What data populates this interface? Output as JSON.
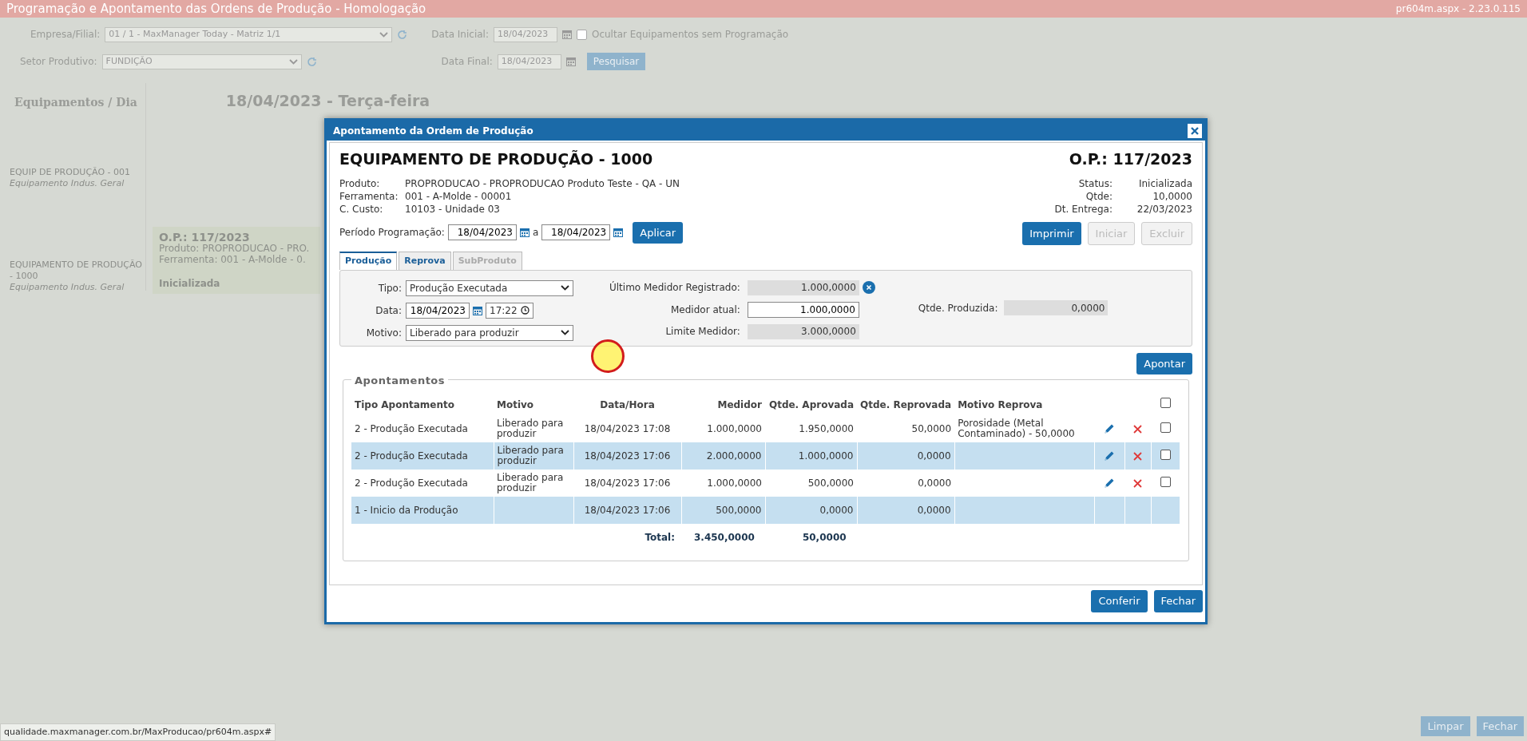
{
  "app_header": {
    "title": "Programação e Apontamento das Ordens de Produção  - Homologação",
    "version": "pr604m.aspx - 2.23.0.115"
  },
  "filters": {
    "empresa_label": "Empresa/Filial:",
    "empresa_value": "01 / 1 - MaxManager Today - Matriz 1/1",
    "setor_label": "Setor Produtivo:",
    "setor_value": "FUNDIÇÃO",
    "data_inicial_label": "Data Inicial:",
    "data_inicial": "18/04/2023",
    "data_final_label": "Data Final:",
    "data_final": "18/04/2023",
    "ocultar_label": "Ocultar Equipamentos sem Programação",
    "ocultar_checked": false,
    "search_button": "Pesquisar"
  },
  "schedule": {
    "corner": "Equipamentos / Dia",
    "day": "18/04/2023 - Terça-feira",
    "equipments": [
      {
        "name": "EQUIP DE PRODUÇÃO - 001",
        "type": "Equipamento Indus. Geral"
      },
      {
        "name": "EQUIPAMENTO DE PRODUÇÃO - 1000",
        "type": "Equipamento Indus. Geral",
        "order": {
          "title": "O.P.: 117/2023",
          "produto": "Produto: PROPRODUCAO - PRO.",
          "ferramenta": "Ferramenta: 001 - A-Molde - 0.",
          "status": "Inicializada"
        }
      }
    ]
  },
  "modal": {
    "title": "Apontamento da Ordem de Produção",
    "equipment": "EQUIPAMENTO DE PRODUÇÃO - 1000",
    "op": "O.P.: 117/2023",
    "info": [
      {
        "label": "Produto:",
        "value": "PROPRODUCAO - PROPRODUCAO Produto Teste - QA - UN"
      },
      {
        "label": "Ferramenta:",
        "value": "001 - A-Molde - 00001"
      },
      {
        "label": "C. Custo:",
        "value": "10103 - Unidade 03"
      }
    ],
    "status_info": [
      {
        "label": "Status:",
        "value": "Inicializada"
      },
      {
        "label": "Qtde:",
        "value": "10,0000"
      },
      {
        "label": "Dt. Entrega:",
        "value": "22/03/2023"
      }
    ],
    "period": {
      "label": "Período Programação:",
      "from": "18/04/2023",
      "separator": "a",
      "to": "18/04/2023",
      "apply": "Aplicar"
    },
    "actions": [
      {
        "label": "Imprimir",
        "disabled": false
      },
      {
        "label": "Iniciar",
        "disabled": true
      },
      {
        "label": "Excluir",
        "disabled": true
      }
    ],
    "tabs": [
      {
        "label": "Produção",
        "selected": true,
        "disabled": false
      },
      {
        "label": "Reprova",
        "selected": false,
        "disabled": false
      },
      {
        "label": "SubProduto",
        "selected": false,
        "disabled": true
      }
    ],
    "form": {
      "tipo_label": "Tipo:",
      "tipo": "Produção Executada",
      "data_label": "Data:",
      "data": "18/04/2023",
      "hora": "17:22",
      "motivo_label": "Motivo:",
      "motivo": "Liberado para produzir",
      "ultimo_label": "Último Medidor Registrado:",
      "ultimo": "1.000,0000",
      "atual_label": "Medidor atual:",
      "atual": "1.000,0000",
      "limite_label": "Limite Medidor:",
      "limite": "3.000,0000",
      "produzida_label": "Qtde. Produzida:",
      "produzida": "0,0000"
    },
    "apontar": "Apontar",
    "section": "Apontamentos",
    "columns": [
      "Tipo Apontamento",
      "Motivo",
      "Data/Hora",
      "Medidor",
      "Qtde. Aprovada",
      "Qtde. Reprovada",
      "Motivo Reprova"
    ],
    "header_checked": false,
    "rows": [
      {
        "tipo": "2 - Produção Executada",
        "motivo": "Liberado para produzir",
        "data": "18/04/2023 17:08",
        "medidor": "1.000,0000",
        "aprovada": "1.950,0000",
        "reprovada": "50,0000",
        "motivo_reprova": "Porosidade (Metal Contaminado) - 50,0000",
        "editable": true,
        "checked": false
      },
      {
        "tipo": "2 - Produção Executada",
        "motivo": "Liberado para produzir",
        "data": "18/04/2023 17:06",
        "medidor": "2.000,0000",
        "aprovada": "1.000,0000",
        "reprovada": "0,0000",
        "editable": true,
        "checked": false
      },
      {
        "tipo": "2 - Produção Executada",
        "motivo": "Liberado para produzir",
        "data": "18/04/2023 17:06",
        "medidor": "1.000,0000",
        "aprovada": "500,0000",
        "reprovada": "0,0000",
        "editable": true,
        "checked": false
      },
      {
        "tipo": "1 - Inicio da Produção",
        "data": "18/04/2023 17:06",
        "medidor": "500,0000",
        "aprovada": "0,0000",
        "reprovada": "0,0000",
        "editable": false
      }
    ],
    "totals": {
      "label": "Total:",
      "aprovada": "3.450,0000",
      "reprovada": "50,0000"
    },
    "footer": [
      {
        "label": "Conferir"
      },
      {
        "label": "Fechar"
      }
    ]
  },
  "footer_buttons": [
    {
      "label": "Limpar"
    },
    {
      "label": "Fechar"
    }
  ],
  "status_url": "qualidade.maxmanager.com.br/MaxProducao/pr604m.aspx#"
}
